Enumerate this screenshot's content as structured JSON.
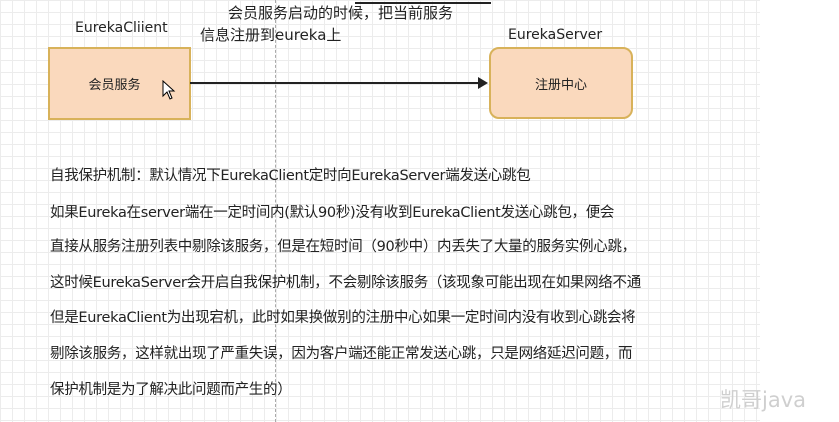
{
  "diagram": {
    "annotation_line1": "会员服务启动的时候，把当前服务",
    "annotation_line2": "信息注册到eureka上",
    "client": {
      "title": "EurekaCliient",
      "box_label": "会员服务"
    },
    "server": {
      "title": "EurekaServer",
      "box_label": "注册中心"
    }
  },
  "notes": [
    "自我保护机制：默认情况下EurekaClient定时向EurekaServer端发送心跳包",
    "如果Eureka在server端在一定时间内(默认90秒)没有收到EurekaClient发送心跳包，便会",
    "直接从服务注册列表中剔除该服务，但是在短时间（90秒中）内丢失了大量的服务实例心跳，",
    "这时候EurekaServer会开启自我保护机制，不会剔除该服务（该现象可能出现在如果网络不通",
    "但是EurekaClient为出现宕机，此时如果换做别的注册中心如果一定时间内没有收到心跳会将",
    "剔除该服务，这样就出现了严重失误，因为客户端还能正常发送心跳，只是网络延迟问题，而",
    "保护机制是为了解决此问题而产生的）"
  ],
  "watermark": "凯哥java"
}
